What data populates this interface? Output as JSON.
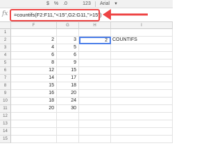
{
  "toolbar": {
    "zoom_label": "123",
    "font_label": "Arial",
    "dollar_label": "$",
    "percent_label": "%",
    "dec_label": ".0"
  },
  "formula_bar": {
    "fx_label": "fx",
    "formula": "=countifs(F2:F11,\"<15\",G2:G11,\">15\")"
  },
  "sheet": {
    "columns": [
      "F",
      "G",
      "H",
      "I"
    ],
    "rows": [
      {
        "num": "1",
        "f": "",
        "g": "",
        "h": "",
        "i": ""
      },
      {
        "num": "2",
        "f": "2",
        "g": "3",
        "h": "2",
        "i": "COUNTIFS"
      },
      {
        "num": "3",
        "f": "4",
        "g": "5",
        "h": "",
        "i": ""
      },
      {
        "num": "4",
        "f": "6",
        "g": "6",
        "h": "",
        "i": ""
      },
      {
        "num": "5",
        "f": "8",
        "g": "9",
        "h": "",
        "i": ""
      },
      {
        "num": "6",
        "f": "12",
        "g": "15",
        "h": "",
        "i": ""
      },
      {
        "num": "7",
        "f": "14",
        "g": "17",
        "h": "",
        "i": ""
      },
      {
        "num": "8",
        "f": "15",
        "g": "18",
        "h": "",
        "i": ""
      },
      {
        "num": "9",
        "f": "16",
        "g": "20",
        "h": "",
        "i": ""
      },
      {
        "num": "10",
        "f": "18",
        "g": "24",
        "h": "",
        "i": ""
      },
      {
        "num": "11",
        "f": "20",
        "g": "30",
        "h": "",
        "i": ""
      },
      {
        "num": "12",
        "f": "",
        "g": "",
        "h": "",
        "i": ""
      },
      {
        "num": "13",
        "f": "",
        "g": "",
        "h": "",
        "i": ""
      },
      {
        "num": "14",
        "f": "",
        "g": "",
        "h": "",
        "i": ""
      },
      {
        "num": "15",
        "f": "",
        "g": "",
        "h": "",
        "i": ""
      }
    ]
  },
  "colors": {
    "highlight": "#e44444",
    "selection": "#4a7de8"
  }
}
